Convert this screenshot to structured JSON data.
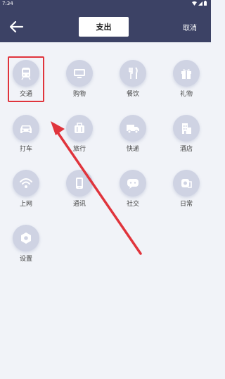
{
  "status_bar": {
    "time": "7:34"
  },
  "header": {
    "tab_label": "支出",
    "cancel_label": "取消"
  },
  "categories": [
    {
      "label": "交通",
      "icon": "train-icon"
    },
    {
      "label": "购物",
      "icon": "monitor-icon"
    },
    {
      "label": "餐饮",
      "icon": "utensils-icon"
    },
    {
      "label": "礼物",
      "icon": "gift-icon"
    },
    {
      "label": "打车",
      "icon": "car-icon"
    },
    {
      "label": "旅行",
      "icon": "luggage-icon"
    },
    {
      "label": "快递",
      "icon": "truck-icon"
    },
    {
      "label": "酒店",
      "icon": "hotel-icon"
    },
    {
      "label": "上网",
      "icon": "wifi-icon"
    },
    {
      "label": "通讯",
      "icon": "phone-icon"
    },
    {
      "label": "社交",
      "icon": "chat-icon"
    },
    {
      "label": "日常",
      "icon": "tissue-icon"
    },
    {
      "label": "设置",
      "icon": "settings-icon"
    }
  ],
  "colors": {
    "header_bg": "#3c4265",
    "page_bg": "#f1f3f8",
    "icon_circle": "#cfd3e3",
    "highlight": "#e0343c"
  }
}
